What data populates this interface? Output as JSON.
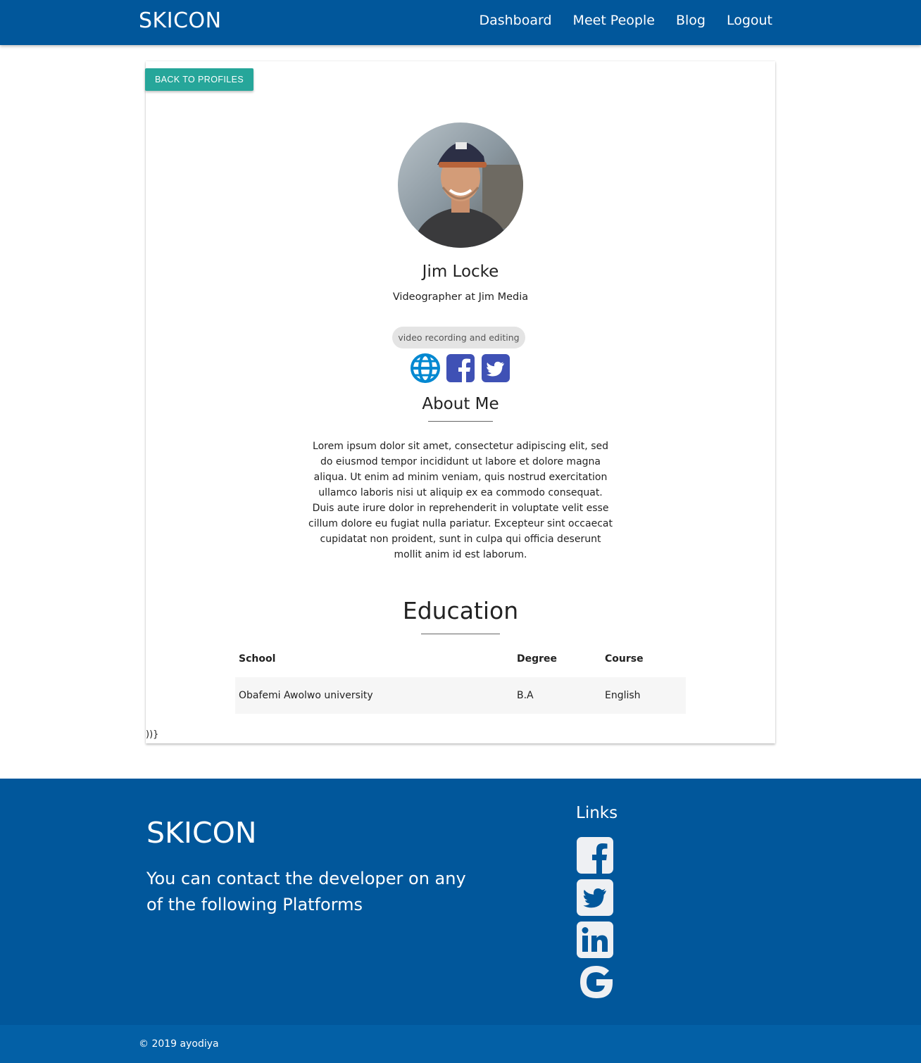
{
  "navbar": {
    "brand": "SKICON",
    "links": [
      "Dashboard",
      "Meet People",
      "Blog",
      "Logout"
    ]
  },
  "profile": {
    "back_label": "BACK TO PROFILES",
    "name": "Jim Locke",
    "title": "Videographer at Jim Media",
    "skill": "video recording and editing",
    "social_icons": [
      "globe-icon",
      "facebook-icon",
      "twitter-icon"
    ],
    "about_heading": "About Me",
    "about_text": "Lorem ipsum dolor sit amet, consectetur adipiscing elit, sed do eiusmod tempor incididunt ut labore et dolore magna aliqua. Ut enim ad minim veniam, quis nostrud exercitation ullamco laboris nisi ut aliquip ex ea commodo consequat. Duis aute irure dolor in reprehenderit in voluptate velit esse cillum dolore eu fugiat nulla pariatur. Excepteur sint occaecat cupidatat non proident, sunt in culpa qui officia deserunt mollit anim id est laborum.",
    "education_heading": "Education",
    "education_columns": [
      "School",
      "Degree",
      "Course"
    ],
    "education_rows": [
      [
        "Obafemi Awolwo university",
        "B.A",
        "English"
      ]
    ],
    "stray_text": "))}"
  },
  "footer": {
    "brand": "SKICON",
    "contact_text": "You can contact the developer on any of the following Platforms",
    "links_heading": "Links",
    "link_icons": [
      "facebook-icon",
      "twitter-icon",
      "linkedin-icon",
      "google-icon"
    ],
    "copyright": "© 2019 ayodiya"
  },
  "colors": {
    "primary": "#01579b",
    "accent": "#26a69a",
    "social_blue": "#3f51b5",
    "globe_blue": "#0288d1"
  }
}
